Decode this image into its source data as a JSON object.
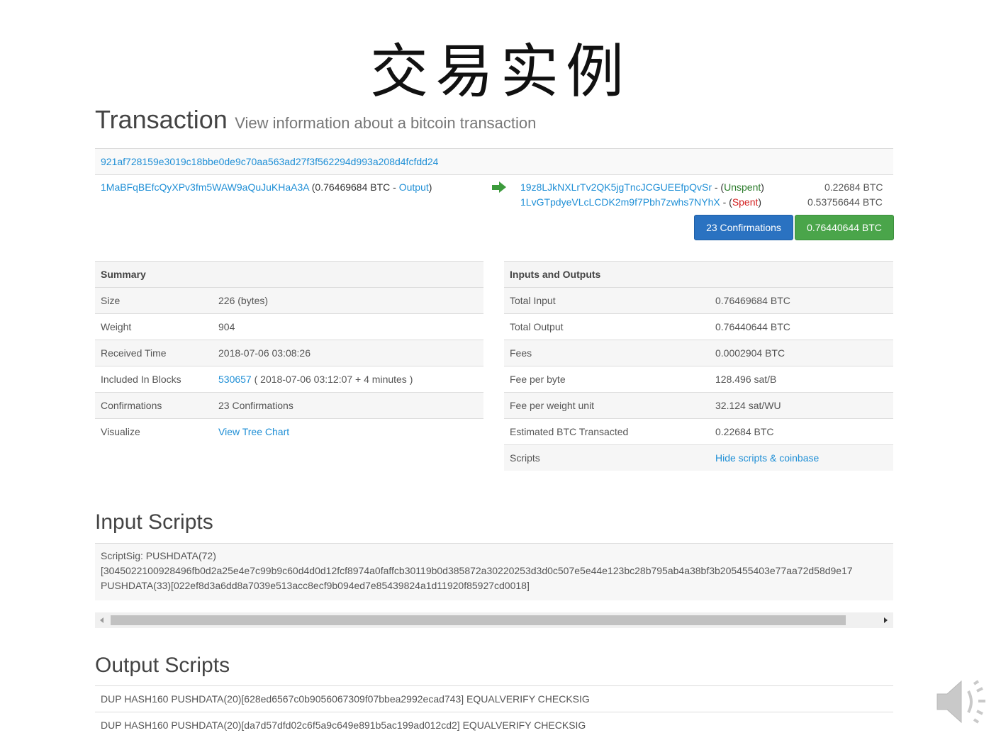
{
  "slide": {
    "title": "交易实例"
  },
  "header": {
    "title": "Transaction",
    "subtitle": "View information about a bitcoin transaction"
  },
  "tx": {
    "hash": "921af728159e3019c18bbe0de9c70aa563ad27f3f562294d993a208d4fcfdd24",
    "input": {
      "address": "1MaBFqBEfcQyXPv3fm5WAW9aQuJuKHaA3A",
      "amount_prefix": " (0.76469684 BTC - ",
      "link": "Output",
      "suffix": ")"
    },
    "outputs": [
      {
        "address": "19z8LJkNXLrTv2QK5jgTncJCGUEEfpQvSr",
        "sep": " - (",
        "status": "Unspent",
        "close": ")",
        "amount": "0.22684 BTC"
      },
      {
        "address": "1LvGTpdyeVLcLCDK2m9f7Pbh7zwhs7NYhX",
        "sep": " - (",
        "status": "Spent",
        "close": ")",
        "amount": "0.53756644 BTC"
      }
    ],
    "confirmations_button": "23 Confirmations",
    "total_button": "0.76440644 BTC"
  },
  "summary": {
    "heading": "Summary",
    "size_label": "Size",
    "size_value": "226 (bytes)",
    "weight_label": "Weight",
    "weight_value": "904",
    "received_label": "Received Time",
    "received_value": "2018-07-06 03:08:26",
    "blocks_label": "Included In Blocks",
    "blocks_link": "530657",
    "blocks_rest": " ( 2018-07-06 03:12:07 + 4 minutes )",
    "confirmations_label": "Confirmations",
    "confirmations_value": "23 Confirmations",
    "visualize_label": "Visualize",
    "visualize_link": "View Tree Chart"
  },
  "io": {
    "heading": "Inputs and Outputs",
    "rows": [
      {
        "label": "Total Input",
        "value": "0.76469684 BTC"
      },
      {
        "label": "Total Output",
        "value": "0.76440644 BTC"
      },
      {
        "label": "Fees",
        "value": "0.0002904 BTC"
      },
      {
        "label": "Fee per byte",
        "value": "128.496 sat/B"
      },
      {
        "label": "Fee per weight unit",
        "value": "32.124 sat/WU"
      },
      {
        "label": "Estimated BTC Transacted",
        "value": "0.22684 BTC"
      }
    ],
    "scripts_label": "Scripts",
    "scripts_link": "Hide scripts & coinbase"
  },
  "input_scripts": {
    "title": "Input Scripts",
    "line1": "ScriptSig: PUSHDATA(72)",
    "line2": "[3045022100928496fb0d2a25e4e7c99b9c60d4d0d12fcf8974a0faffcb30119b0d385872a30220253d3d0c507e5e44e123bc28b795ab4a38bf3b205455403e77aa72d58d9e17",
    "line3": "PUSHDATA(33)[022ef8d3a6dd8a7039e513acc8ecf9b094ed7e85439824a1d11920f85927cd0018]"
  },
  "output_scripts": {
    "title": "Output Scripts",
    "rows": [
      "DUP HASH160 PUSHDATA(20)[628ed6567c0b9056067309f07bbea2992ecad743] EQUALVERIFY CHECKSIG",
      "DUP HASH160 PUSHDATA(20)[da7d57dfd02c6f5a9c649e891b5ac199ad012cd2] EQUALVERIFY CHECKSIG"
    ]
  },
  "colors": {
    "link": "#1f8fd6",
    "confirm_button": "#2a72c1",
    "total_button": "#4aa54a",
    "unspent": "#2b7b2b",
    "spent": "#d32020"
  },
  "icons": {
    "arrow": "right-arrow-icon",
    "speaker": "speaker-icon"
  }
}
